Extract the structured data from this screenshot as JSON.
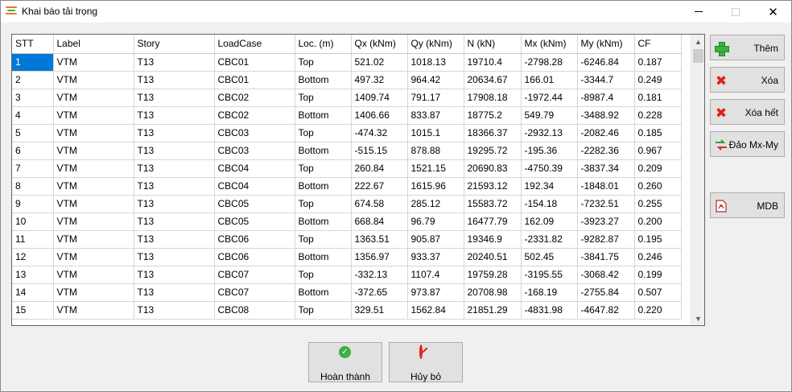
{
  "window": {
    "title": "Khai báo tải trọng"
  },
  "table": {
    "columns": [
      "STT",
      "Label",
      "Story",
      "LoadCase",
      "Loc. (m)",
      "Qx (kNm)",
      "Qy (kNm)",
      "N (kN)",
      "Mx (kNm)",
      "My (kNm)",
      "CF"
    ],
    "rows": [
      [
        "1",
        "VTM",
        "T13",
        "CBC01",
        "Top",
        "521.02",
        "1018.13",
        "19710.4",
        "-2798.28",
        "-6246.84",
        "0.187"
      ],
      [
        "2",
        "VTM",
        "T13",
        "CBC01",
        "Bottom",
        "497.32",
        "964.42",
        "20634.67",
        "166.01",
        "-3344.7",
        "0.249"
      ],
      [
        "3",
        "VTM",
        "T13",
        "CBC02",
        "Top",
        "1409.74",
        "791.17",
        "17908.18",
        "-1972.44",
        "-8987.4",
        "0.181"
      ],
      [
        "4",
        "VTM",
        "T13",
        "CBC02",
        "Bottom",
        "1406.66",
        "833.87",
        "18775.2",
        "549.79",
        "-3488.92",
        "0.228"
      ],
      [
        "5",
        "VTM",
        "T13",
        "CBC03",
        "Top",
        "-474.32",
        "1015.1",
        "18366.37",
        "-2932.13",
        "-2082.46",
        "0.185"
      ],
      [
        "6",
        "VTM",
        "T13",
        "CBC03",
        "Bottom",
        "-515.15",
        "878.88",
        "19295.72",
        "-195.36",
        "-2282.36",
        "0.967"
      ],
      [
        "7",
        "VTM",
        "T13",
        "CBC04",
        "Top",
        "260.84",
        "1521.15",
        "20690.83",
        "-4750.39",
        "-3837.34",
        "0.209"
      ],
      [
        "8",
        "VTM",
        "T13",
        "CBC04",
        "Bottom",
        "222.67",
        "1615.96",
        "21593.12",
        "192.34",
        "-1848.01",
        "0.260"
      ],
      [
        "9",
        "VTM",
        "T13",
        "CBC05",
        "Top",
        "674.58",
        "285.12",
        "15583.72",
        "-154.18",
        "-7232.51",
        "0.255"
      ],
      [
        "10",
        "VTM",
        "T13",
        "CBC05",
        "Bottom",
        "668.84",
        "96.79",
        "16477.79",
        "162.09",
        "-3923.27",
        "0.200"
      ],
      [
        "11",
        "VTM",
        "T13",
        "CBC06",
        "Top",
        "1363.51",
        "905.87",
        "19346.9",
        "-2331.82",
        "-9282.87",
        "0.195"
      ],
      [
        "12",
        "VTM",
        "T13",
        "CBC06",
        "Bottom",
        "1356.97",
        "933.37",
        "20240.51",
        "502.45",
        "-3841.75",
        "0.246"
      ],
      [
        "13",
        "VTM",
        "T13",
        "CBC07",
        "Top",
        "-332.13",
        "1107.4",
        "19759.28",
        "-3195.55",
        "-3068.42",
        "0.199"
      ],
      [
        "14",
        "VTM",
        "T13",
        "CBC07",
        "Bottom",
        "-372.65",
        "973.87",
        "20708.98",
        "-168.19",
        "-2755.84",
        "0.507"
      ],
      [
        "15",
        "VTM",
        "T13",
        "CBC08",
        "Top",
        "329.51",
        "1562.84",
        "21851.29",
        "-4831.98",
        "-4647.82",
        "0.220"
      ]
    ],
    "selected_row": 0
  },
  "sidebar": {
    "add": {
      "label": "Thêm",
      "icon": "plus-icon"
    },
    "delete": {
      "label": "Xóa",
      "icon": "x-icon"
    },
    "delete_all": {
      "label": "Xóa hết",
      "icon": "x-icon"
    },
    "swap": {
      "label": "Đảo Mx-My",
      "icon": "swap-arrows-icon"
    },
    "mdb": {
      "label": "MDB",
      "icon": "document-icon"
    }
  },
  "footer": {
    "finish": {
      "label": "Hoàn thành",
      "icon": "check-circle-icon"
    },
    "cancel": {
      "label": "Hủy bỏ",
      "icon": "cancel-circle-icon"
    }
  },
  "colors": {
    "selection": "#0078d7",
    "add_green": "#3cb043",
    "delete_red": "#e0201c"
  }
}
